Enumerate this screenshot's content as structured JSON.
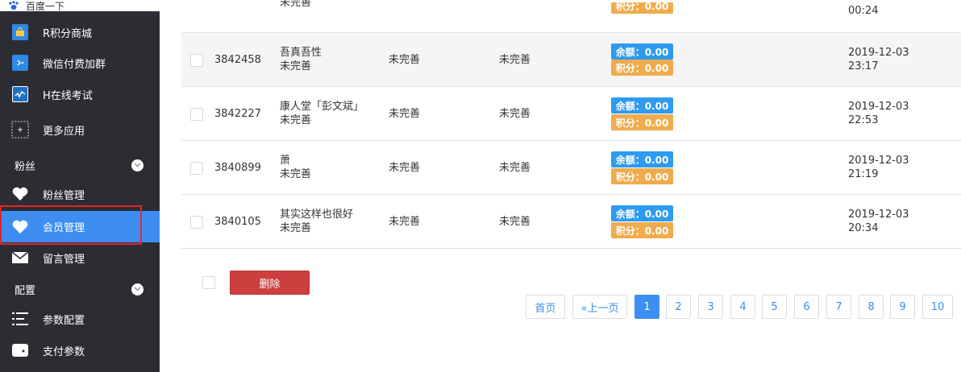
{
  "browser": {
    "tab_title": "百度一下"
  },
  "sidebar": {
    "items_top": [
      {
        "label": "R积分商城",
        "icon": "shopping-bag-icon"
      },
      {
        "label": "微信付费加群",
        "icon": "wechat-group-icon"
      },
      {
        "label": "H在线考试",
        "icon": "exam-chart-icon"
      },
      {
        "label": "更多应用",
        "icon": "more-apps-icon"
      }
    ],
    "group_fans": {
      "label": "粉丝"
    },
    "fans_items": [
      {
        "label": "粉丝管理",
        "icon": "heart-icon"
      },
      {
        "label": "会员管理",
        "icon": "heart-icon"
      },
      {
        "label": "留言管理",
        "icon": "mail-icon"
      }
    ],
    "group_config": {
      "label": "配置"
    },
    "config_items": [
      {
        "label": "参数配置",
        "icon": "settings-list-icon"
      },
      {
        "label": "支付参数",
        "icon": "wallet-icon"
      }
    ]
  },
  "table": {
    "partial_top_row": {
      "name_status": "未完善",
      "points": "积分：0.00",
      "time": "00:24"
    },
    "rows": [
      {
        "id": "3842458",
        "name": "吾真吾性",
        "status": "未完善",
        "col3": "未完善",
        "col4": "未完善",
        "balance": "余额：0.00",
        "points": "积分：0.00",
        "date": "2019-12-03",
        "time": "23:17"
      },
      {
        "id": "3842227",
        "name": "康人堂「彭文斌」",
        "status": "未完善",
        "col3": "未完善",
        "col4": "未完善",
        "balance": "余额：0.00",
        "points": "积分：0.00",
        "date": "2019-12-03",
        "time": "22:53"
      },
      {
        "id": "3840899",
        "name": "萧",
        "status": "未完善",
        "col3": "未完善",
        "col4": "未完善",
        "balance": "余额：0.00",
        "points": "积分：0.00",
        "date": "2019-12-03",
        "time": "21:19"
      },
      {
        "id": "3840105",
        "name": "其实这样也很好",
        "status": "未完善",
        "col3": "未完善",
        "col4": "未完善",
        "balance": "余额：0.00",
        "points": "积分：0.00",
        "date": "2019-12-03",
        "time": "20:34"
      }
    ]
  },
  "footer": {
    "delete_label": "删除"
  },
  "pagination": {
    "first": "首页",
    "prev": "«上一页",
    "pages": [
      "1",
      "2",
      "3",
      "4",
      "5",
      "6",
      "7",
      "8",
      "9",
      "10"
    ],
    "current": "1"
  },
  "colors": {
    "sidebar_bg": "#2b2d33",
    "active": "#3d8ef0",
    "balance_badge": "#2e9bf0",
    "points_badge": "#efac4e",
    "delete": "#cd3f3f",
    "highlight": "#e0262c"
  }
}
